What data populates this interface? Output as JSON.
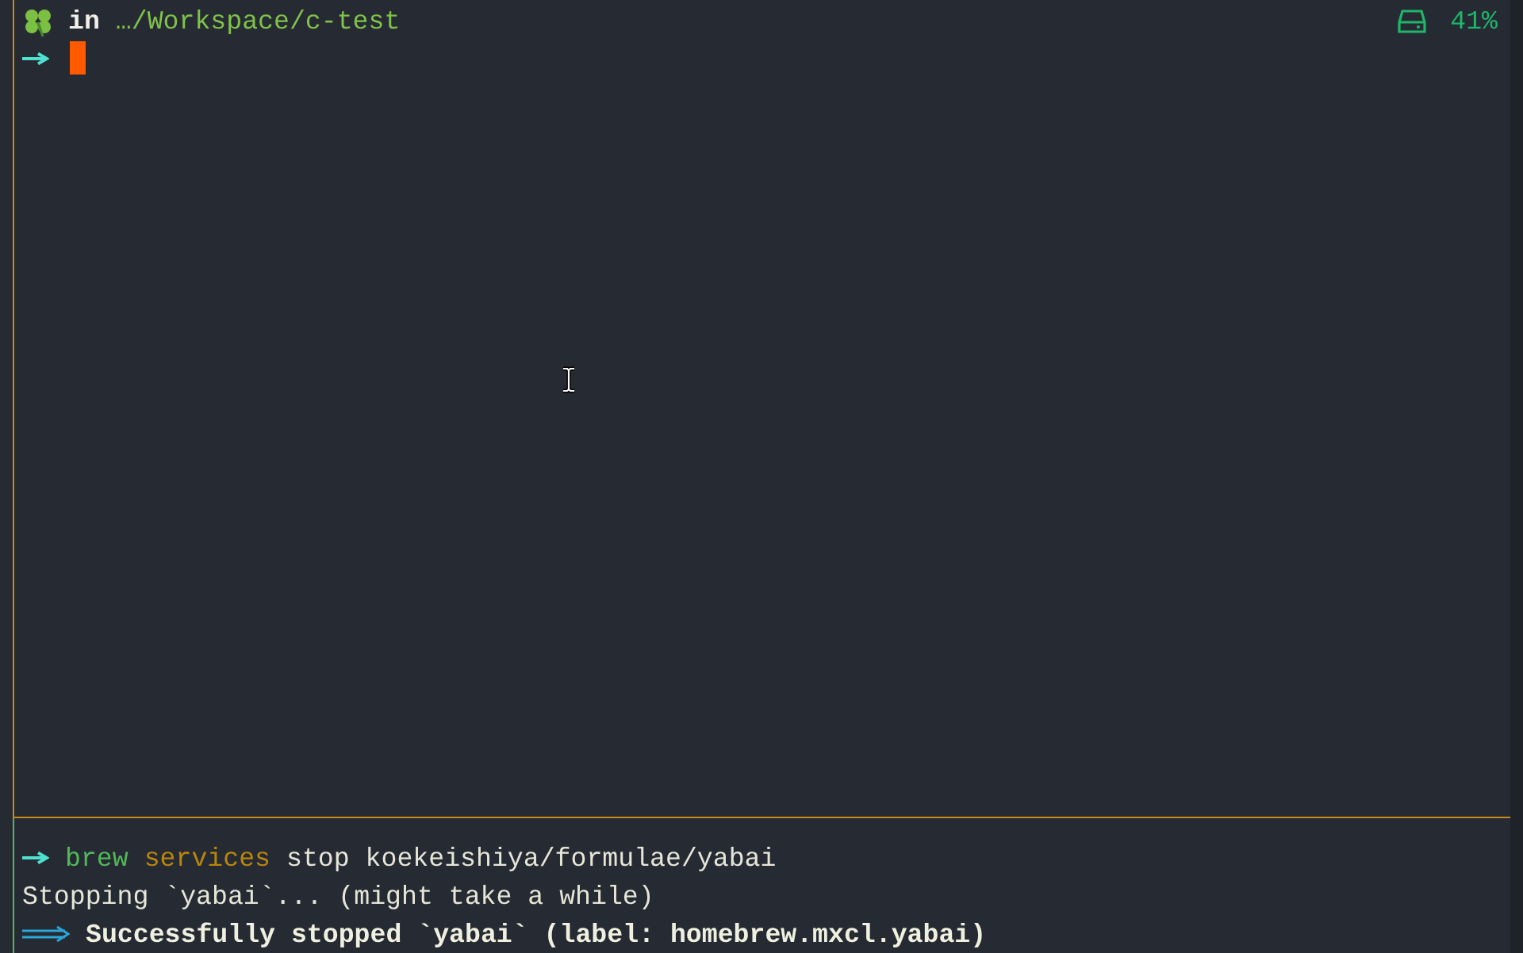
{
  "top_pane": {
    "active": true,
    "prompt": {
      "word": "in",
      "path": "…/Workspace/c-test"
    },
    "disk_status": {
      "percent": "41%"
    }
  },
  "bottom_pane": {
    "active": false,
    "lines": [
      {
        "kind": "command",
        "segments": [
          {
            "kind": "program",
            "text": "brew"
          },
          {
            "kind": "subcommand",
            "text": "services"
          },
          {
            "kind": "plain",
            "text": "stop koekeishiya/formulae/yabai"
          }
        ]
      },
      {
        "kind": "output",
        "segments": [
          {
            "kind": "plain",
            "text": "Stopping `yabai`... (might take a while)"
          }
        ]
      },
      {
        "kind": "success",
        "segments": [
          {
            "kind": "bold",
            "text": "Successfully stopped `yabai` (label: homebrew.mxcl.yabai)"
          }
        ]
      }
    ]
  }
}
